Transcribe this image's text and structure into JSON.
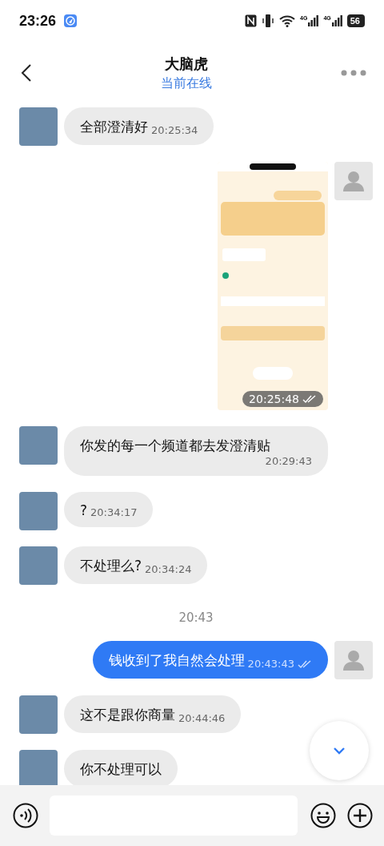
{
  "status_bar": {
    "time": "23:26",
    "networks": [
      "4G",
      "4G"
    ],
    "battery": "56"
  },
  "header": {
    "title": "大脑虎",
    "status": "当前在线"
  },
  "messages": [
    {
      "kind": "text",
      "outgoing": false,
      "text": "全部澄清好",
      "time": "20:25:34",
      "read": false
    },
    {
      "kind": "image",
      "outgoing": true,
      "time": "20:25:48",
      "read": true
    },
    {
      "kind": "text",
      "outgoing": false,
      "text": "你发的每一个频道都去发澄清贴",
      "time": "20:29:43",
      "read": false
    },
    {
      "kind": "text",
      "outgoing": false,
      "text": "?",
      "time": "20:34:17",
      "read": false
    },
    {
      "kind": "text",
      "outgoing": false,
      "text": "不处理么?",
      "time": "20:34:24",
      "read": false
    },
    {
      "kind": "separator",
      "time": "20:43"
    },
    {
      "kind": "text",
      "outgoing": true,
      "text": "钱收到了我自然会处理",
      "time": "20:43:43",
      "read": true
    },
    {
      "kind": "text",
      "outgoing": false,
      "text": "这不是跟你商量",
      "time": "20:44:46",
      "read": false
    },
    {
      "kind": "text",
      "outgoing": false,
      "text": "你不处理可以",
      "read": false
    }
  ]
}
